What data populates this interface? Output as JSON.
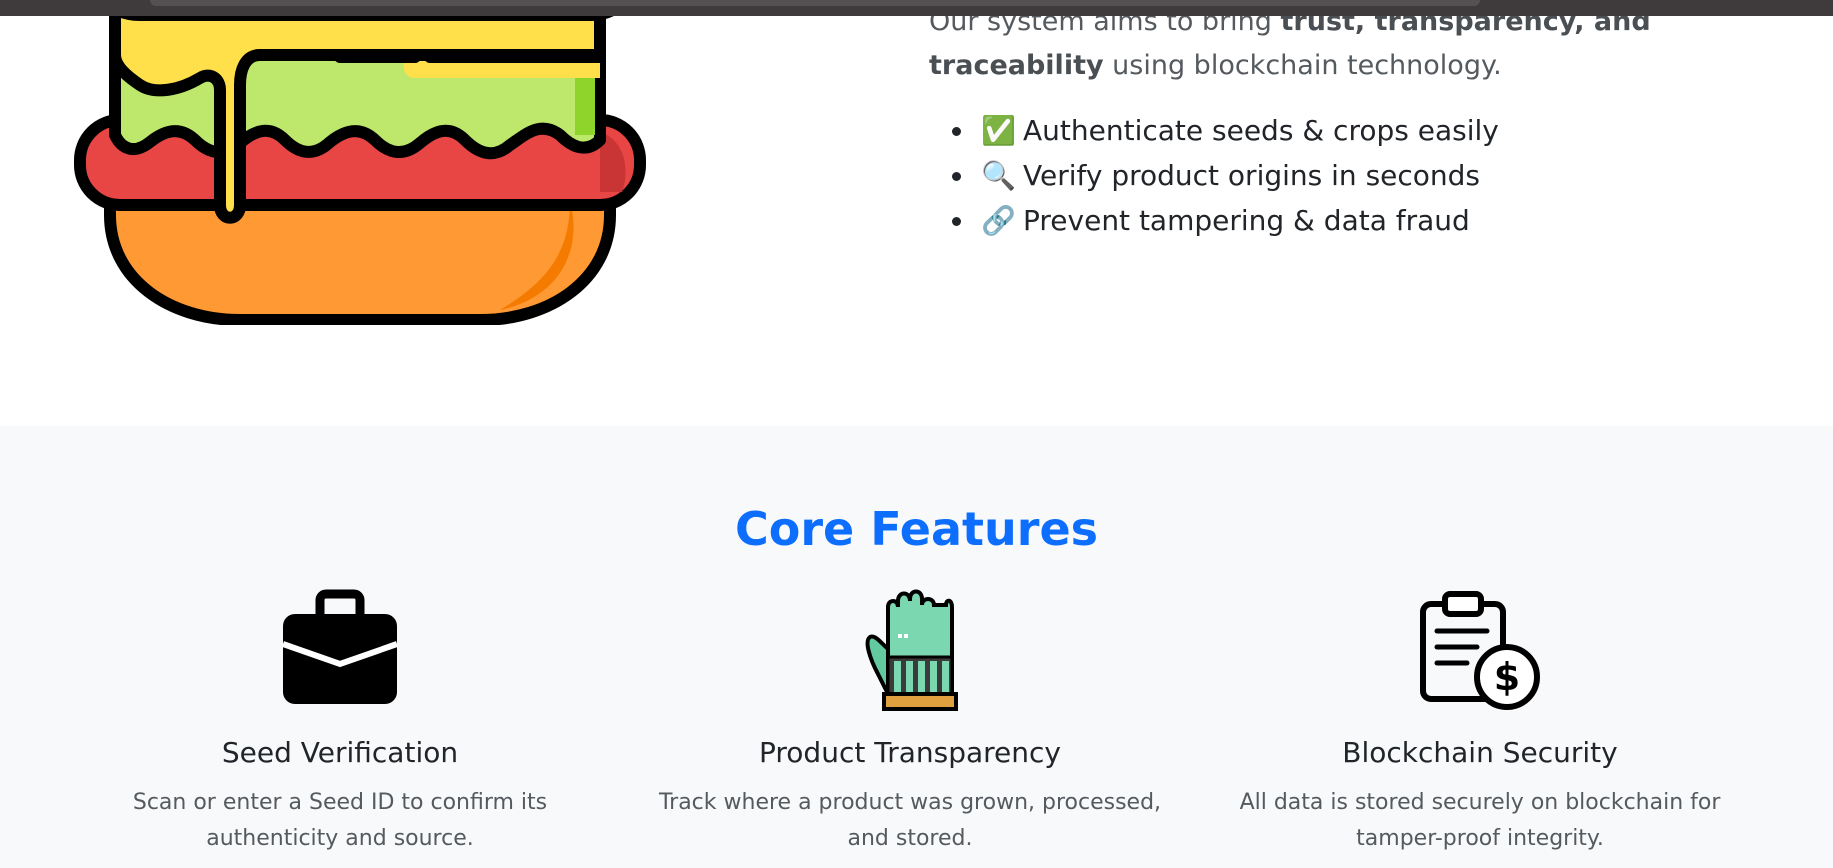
{
  "about": {
    "intro_prefix": "Our system aims to bring ",
    "intro_bold": "trust, transparency, and traceability",
    "intro_suffix": " using blockchain technology.",
    "bullets": [
      {
        "emoji": "✅",
        "icon": "check-mark-icon",
        "text": "Authenticate seeds & crops easily"
      },
      {
        "emoji": "🔍",
        "icon": "magnifier-icon",
        "text": "Verify product origins in seconds"
      },
      {
        "emoji": "🔗",
        "icon": "link-icon",
        "text": "Prevent tampering & data fraud"
      }
    ],
    "illustration": "burger-illustration"
  },
  "features": {
    "title": "Core Features",
    "title_color": "#0d6efd",
    "items": [
      {
        "icon": "briefcase-icon",
        "title": "Seed Verification",
        "desc": "Scan or enter a Seed ID to confirm its authenticity and source."
      },
      {
        "icon": "glove-icon",
        "title": "Product Transparency",
        "desc": "Track where a product was grown, processed, and stored."
      },
      {
        "icon": "clipboard-dollar-icon",
        "title": "Blockchain Security",
        "desc": "All data is stored securely on blockchain for tamper-proof integrity."
      }
    ]
  }
}
